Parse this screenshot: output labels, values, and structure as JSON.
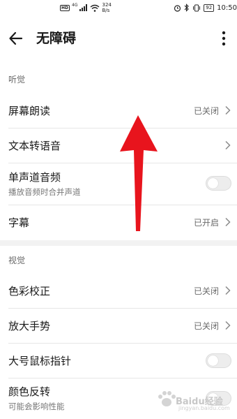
{
  "status_bar": {
    "hd": "HD",
    "network": "4G",
    "speed_value": "324",
    "speed_unit": "B/s",
    "battery": "92",
    "time": "10:50"
  },
  "header": {
    "title": "无障碍"
  },
  "sections": {
    "hearing": {
      "header": "听觉",
      "items": [
        {
          "title": "屏幕朗读",
          "value": "已关闭"
        },
        {
          "title": "文本转语音",
          "value": ""
        },
        {
          "title": "单声道音频",
          "subtitle": "播放音频时合并声道",
          "toggle": false
        },
        {
          "title": "字幕",
          "value": "已开启"
        }
      ]
    },
    "vision": {
      "header": "视觉",
      "items": [
        {
          "title": "色彩校正",
          "value": "已关闭"
        },
        {
          "title": "放大手势",
          "value": "已关闭"
        },
        {
          "title": "大号鼠标指针",
          "toggle": false
        },
        {
          "title": "颜色反转",
          "subtitle": "可能会影响性能",
          "toggle": false
        }
      ]
    }
  },
  "watermark": {
    "text": "Baidu经验",
    "url": "jingyan.baidu.com"
  },
  "colors": {
    "arrow": "#e8141d",
    "background": "#ffffff",
    "divider": "#e6e6e6"
  }
}
